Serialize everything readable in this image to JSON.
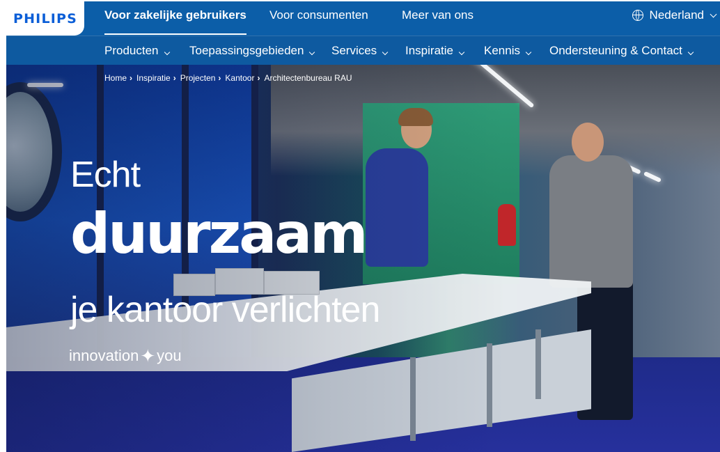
{
  "brand": {
    "logo": "PHILIPS",
    "color": "#0b5ed7"
  },
  "topbar": {
    "links": [
      {
        "label": "Voor zakelijke gebruikers",
        "active": true
      },
      {
        "label": "Voor consumenten",
        "active": false
      },
      {
        "label": "Meer van ons",
        "active": false
      }
    ],
    "language": {
      "label": "Nederland",
      "icon": "globe-icon"
    }
  },
  "nav": {
    "items": [
      {
        "label": "Producten"
      },
      {
        "label": "Toepassingsgebieden"
      },
      {
        "label": "Services"
      },
      {
        "label": "Inspiratie"
      },
      {
        "label": "Kennis"
      },
      {
        "label": "Ondersteuning & Contact"
      }
    ]
  },
  "breadcrumb": [
    "Home",
    "Inspiratie",
    "Projecten",
    "Kantoor",
    "Architectenbureau RAU"
  ],
  "hero": {
    "line1": "Echt",
    "line2": "duurzaam",
    "line3": "je kantoor verlichten",
    "tagline_left": "innovation",
    "tagline_icon": "sparkle-icon",
    "tagline_right": "you"
  }
}
